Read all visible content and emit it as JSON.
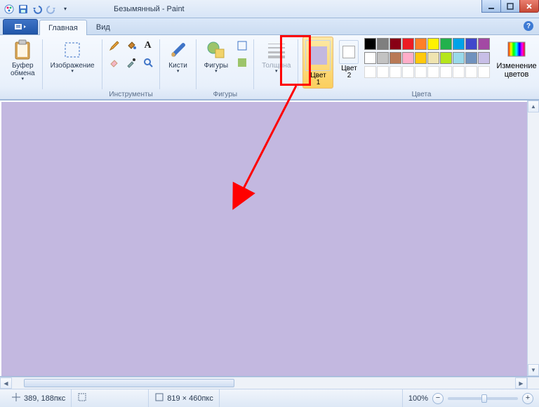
{
  "window": {
    "title": "Безымянный - Paint"
  },
  "tabs": {
    "home": "Главная",
    "view": "Вид"
  },
  "ribbon": {
    "clipboard": {
      "label": "Буфер\nобмена",
      "group": ""
    },
    "image": {
      "label": "Изображение",
      "group": ""
    },
    "tools_group": "Инструменты",
    "brushes": {
      "label": "Кисти"
    },
    "shapes": {
      "label": "Фигуры",
      "group": "Фигуры"
    },
    "size": {
      "label": "Толщина"
    },
    "color1": {
      "label": "Цвет\n1"
    },
    "color2": {
      "label": "Цвет\n2"
    },
    "colors_group": "Цвета",
    "edit_colors": {
      "label": "Изменение\nцветов"
    }
  },
  "colors": {
    "color1_value": "#c3b8e0",
    "color2_value": "#ffffff",
    "palette_row1": [
      "#000000",
      "#7f7f7f",
      "#880015",
      "#ed1c24",
      "#ff7f27",
      "#fff200",
      "#22b14c",
      "#00a2e8",
      "#3f48cc",
      "#a349a4"
    ],
    "palette_row2": [
      "#ffffff",
      "#c3c3c3",
      "#b97a57",
      "#ffaec9",
      "#ffc90e",
      "#efe4b0",
      "#b5e61d",
      "#99d9ea",
      "#7092be",
      "#c8bfe7"
    ]
  },
  "canvas": {
    "fill": "#c3b8e0"
  },
  "status": {
    "coords": "389, 188пкс",
    "size": "819 × 460пкс",
    "zoom": "100%"
  }
}
